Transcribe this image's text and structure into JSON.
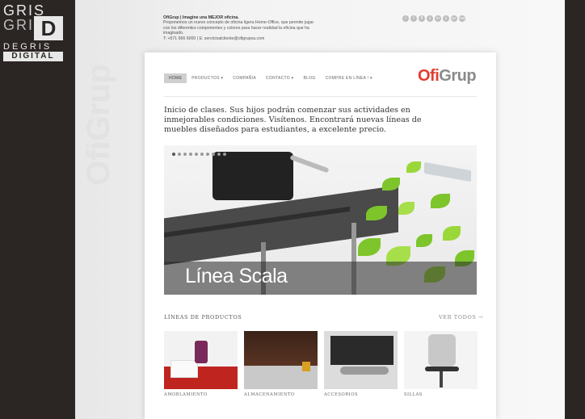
{
  "brand": {
    "line1": "GRIS",
    "line2": "GRIS",
    "letter": "D",
    "line3": "DEGRIS",
    "line4": "DIGITAL"
  },
  "watermark": {
    "text": "OfiGrup"
  },
  "header": {
    "title": "OfiGrup | Imagine una MEJOR oficina.",
    "line2": "Proponemos un nuevo concepto de oficina ligera Home-Office, que permite jugar con los diferentes componentes y colores para hacer realidad la oficina que ha imaginado.",
    "contact": "T: +571 666 6000 | E: servicioalcliente@ofigrupsa.com"
  },
  "social_icons": [
    "t",
    "f",
    "fl",
    "v",
    "in",
    "y",
    "g+",
    "rss"
  ],
  "nav": {
    "items": [
      "HOME",
      "PRODUCTOS ▾",
      "COMPAÑÍA",
      "CONTACTO ▾",
      "BLOG",
      "COMPRE EN LÍNEA ! ▾"
    ]
  },
  "logo": {
    "part1": "Ofi",
    "part2": "Grup"
  },
  "intro": "Inicio de clases. Sus hijos podrán comenzar sus actividades en inmejorables condiciones. Visítenos. Encontrará nuevas líneas de muebles diseñados para estudiantes, a excelente precio.",
  "slider": {
    "caption": "Línea Scala",
    "dot_count": 10,
    "active_dot": 0
  },
  "products": {
    "title": "LÍNEAS DE PRODUCTOS",
    "see_all": "VER TODOS →",
    "items": [
      "AMOBLAMIENTO",
      "ALMACENAMIENTO",
      "ACCESORIOS",
      "SILLAS"
    ]
  },
  "colors": {
    "accent_red": "#e33b2e",
    "leaf_green": "#7dc52b",
    "logo_gray": "#8a8a8a"
  }
}
